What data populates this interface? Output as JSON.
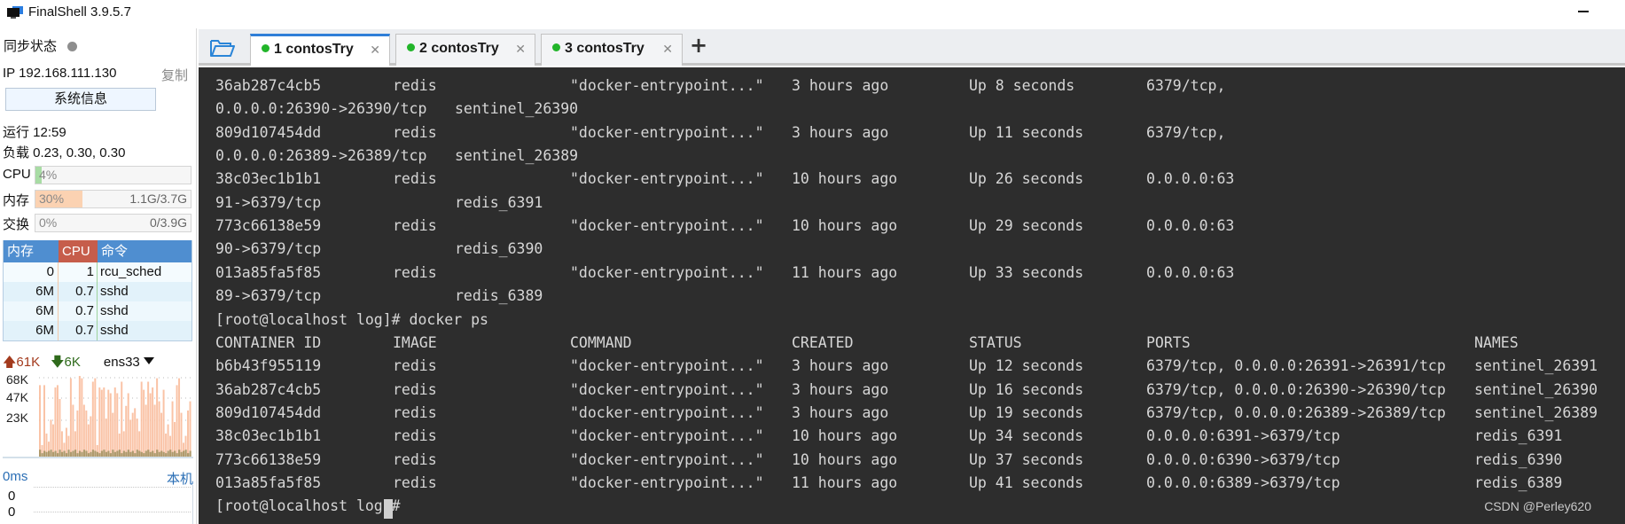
{
  "window": {
    "title": "FinalShell 3.9.5.7"
  },
  "sidebar": {
    "sync_label": "同步状态",
    "ip_label": "IP 192.168.111.130",
    "copy_label": "复制",
    "sysinfo_button": "系统信息",
    "uptime": "运行 12:59",
    "load": "负载 0.23, 0.30, 0.30",
    "cpu": {
      "label": "CPU",
      "percent_text": "4%",
      "percent": 4
    },
    "memory": {
      "label": "内存",
      "percent_text": "30%",
      "percent": 30,
      "amount": "1.1G/3.7G"
    },
    "swap": {
      "label": "交换",
      "percent_text": "0%",
      "percent": 0,
      "amount": "0/3.9G"
    },
    "process_table": {
      "headers": [
        "内存",
        "CPU",
        "命令"
      ],
      "rows": [
        {
          "mem": "0",
          "cpu": "1",
          "cmd": "rcu_sched"
        },
        {
          "mem": "6M",
          "cpu": "0.7",
          "cmd": "sshd"
        },
        {
          "mem": "6M",
          "cpu": "0.7",
          "cmd": "sshd"
        },
        {
          "mem": "6M",
          "cpu": "0.7",
          "cmd": "sshd"
        }
      ]
    },
    "network": {
      "upload": "61K",
      "download": "6K",
      "interface": "ens33",
      "y_labels": [
        "68K",
        "47K",
        "23K"
      ],
      "colors": {
        "upload": "#f9b996",
        "download": "#9c8f5c"
      },
      "upload_series": [
        62,
        10,
        62,
        20,
        13,
        32,
        28,
        60,
        62,
        50,
        22,
        12,
        25,
        18,
        68,
        45,
        22,
        40,
        70,
        68,
        45,
        40,
        28,
        35,
        65,
        68,
        10,
        60,
        58,
        60,
        33,
        58,
        55,
        38,
        60,
        55,
        20,
        65,
        22,
        44,
        55,
        32,
        38,
        42,
        33,
        22,
        65,
        58,
        45,
        65,
        55,
        60,
        45,
        68,
        48,
        38,
        58,
        20,
        28,
        18,
        48,
        30,
        62,
        68,
        38,
        12,
        18,
        40,
        48
      ],
      "download_series": [
        6,
        3,
        5,
        4,
        5,
        6,
        4,
        5,
        3,
        6,
        4,
        5,
        3,
        6,
        4,
        5,
        6,
        3,
        5,
        4,
        6,
        5,
        3,
        4,
        6,
        5,
        4,
        3,
        5,
        6,
        4,
        5,
        3,
        6,
        4,
        5,
        6,
        3,
        5,
        4,
        6,
        4,
        5,
        3,
        6,
        5,
        4,
        3,
        5,
        6,
        4,
        5,
        3,
        6,
        4,
        5,
        4,
        3,
        5,
        6,
        4,
        5,
        3,
        6,
        4,
        5,
        6,
        3,
        5
      ],
      "y_max": 70
    },
    "ping": {
      "latency": "0ms",
      "host": "本机",
      "values": [
        "0",
        "0",
        "0"
      ]
    }
  },
  "tabs": [
    {
      "label": "1 contosTry",
      "active": true
    },
    {
      "label": "2 contosTry",
      "active": false
    },
    {
      "label": "3 contosTry",
      "active": false
    }
  ],
  "terminal": {
    "prompt": "[root@localhost log]# ",
    "command": "docker ps",
    "previous_output": [
      {
        "id": "36ab287c4cb5",
        "image": "redis",
        "command": "\"docker-entrypoint...\"",
        "created": "3 hours ago",
        "status": "Up 8 seconds",
        "ports": "6379/tcp,",
        "wrap_ports": "0.0.0.0:26390->26390/tcp",
        "wrap_name": "sentinel_26390"
      },
      {
        "id": "809d107454dd",
        "image": "redis",
        "command": "\"docker-entrypoint...\"",
        "created": "3 hours ago",
        "status": "Up 11 seconds",
        "ports": "6379/tcp,",
        "wrap_ports": "0.0.0.0:26389->26389/tcp",
        "wrap_name": "sentinel_26389"
      },
      {
        "id": "38c03ec1b1b1",
        "image": "redis",
        "command": "\"docker-entrypoint...\"",
        "created": "10 hours ago",
        "status": "Up 26 seconds",
        "ports": "0.0.0.0:63",
        "wrap_ports": "91->6379/tcp",
        "wrap_name": "redis_6391"
      },
      {
        "id": "773c66138e59",
        "image": "redis",
        "command": "\"docker-entrypoint...\"",
        "created": "10 hours ago",
        "status": "Up 29 seconds",
        "ports": "0.0.0.0:63",
        "wrap_ports": "90->6379/tcp",
        "wrap_name": "redis_6390"
      },
      {
        "id": "013a85fa5f85",
        "image": "redis",
        "command": "\"docker-entrypoint...\"",
        "created": "11 hours ago",
        "status": "Up 33 seconds",
        "ports": "0.0.0.0:63",
        "wrap_ports": "89->6379/tcp",
        "wrap_name": "redis_6389"
      }
    ],
    "headers": [
      "CONTAINER ID",
      "IMAGE",
      "COMMAND",
      "CREATED",
      "STATUS",
      "PORTS",
      "NAMES"
    ],
    "rows": [
      {
        "id": "b6b43f955119",
        "image": "redis",
        "command": "\"docker-entrypoint...\"",
        "created": "3 hours ago",
        "status": "Up 12 seconds",
        "ports": "6379/tcp, 0.0.0.0:26391->26391/tcp",
        "name": "sentinel_26391"
      },
      {
        "id": "36ab287c4cb5",
        "image": "redis",
        "command": "\"docker-entrypoint...\"",
        "created": "3 hours ago",
        "status": "Up 16 seconds",
        "ports": "6379/tcp, 0.0.0.0:26390->26390/tcp",
        "name": "sentinel_26390"
      },
      {
        "id": "809d107454dd",
        "image": "redis",
        "command": "\"docker-entrypoint...\"",
        "created": "3 hours ago",
        "status": "Up 19 seconds",
        "ports": "6379/tcp, 0.0.0.0:26389->26389/tcp",
        "name": "sentinel_26389"
      },
      {
        "id": "38c03ec1b1b1",
        "image": "redis",
        "command": "\"docker-entrypoint...\"",
        "created": "10 hours ago",
        "status": "Up 34 seconds",
        "ports": "0.0.0.0:6391->6379/tcp",
        "name": "redis_6391"
      },
      {
        "id": "773c66138e59",
        "image": "redis",
        "command": "\"docker-entrypoint...\"",
        "created": "10 hours ago",
        "status": "Up 37 seconds",
        "ports": "0.0.0.0:6390->6379/tcp",
        "name": "redis_6390"
      },
      {
        "id": "013a85fa5f85",
        "image": "redis",
        "command": "\"docker-entrypoint...\"",
        "created": "11 hours ago",
        "status": "Up 41 seconds",
        "ports": "0.0.0.0:6389->6379/tcp",
        "name": "redis_6389"
      }
    ],
    "watermark": "CSDN @Perley620"
  }
}
